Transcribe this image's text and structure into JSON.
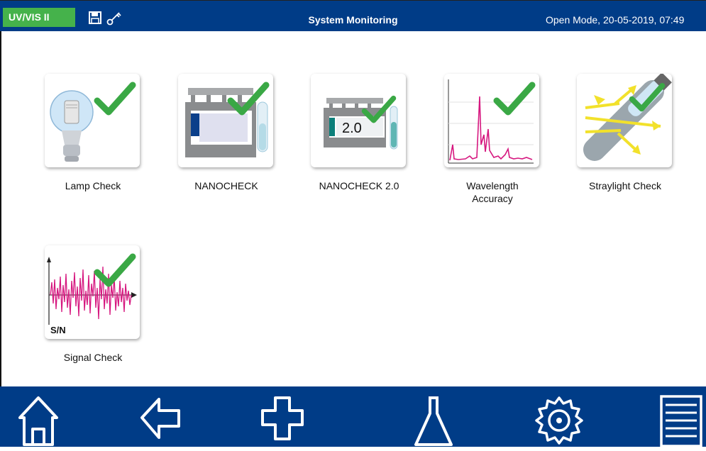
{
  "header": {
    "app_badge": "UV/VIS II",
    "title": "System Monitoring",
    "status": "Open Mode, 20-05-2019, 07:49",
    "icons": [
      "save-icon",
      "key-icon"
    ]
  },
  "tiles": [
    {
      "label": "Lamp Check",
      "icon": "lamp-check-icon",
      "status": "passed"
    },
    {
      "label": "NANOCHECK",
      "icon": "nanocheck-icon",
      "status": "passed"
    },
    {
      "label": "NANOCHECK 2.0",
      "icon": "nanocheck-2-icon",
      "status": "passed",
      "card_text": "2.0"
    },
    {
      "label": "Wavelength\nAccuracy",
      "icon": "wavelength-accuracy-icon",
      "status": "passed"
    },
    {
      "label": "Straylight Check",
      "icon": "straylight-check-icon",
      "status": "passed"
    },
    {
      "label": "Signal Check",
      "icon": "signal-check-icon",
      "status": "passed",
      "card_text": "S/N"
    }
  ],
  "footer": {
    "buttons": [
      "home-icon",
      "back-arrow-icon",
      "plus-icon",
      "flask-icon",
      "settings-gear-icon",
      "menu-list-icon"
    ]
  },
  "colors": {
    "header_bg": "#003c87",
    "badge_bg": "#45b24b",
    "check_green": "#3aa845",
    "signal_magenta": "#d6177f"
  }
}
